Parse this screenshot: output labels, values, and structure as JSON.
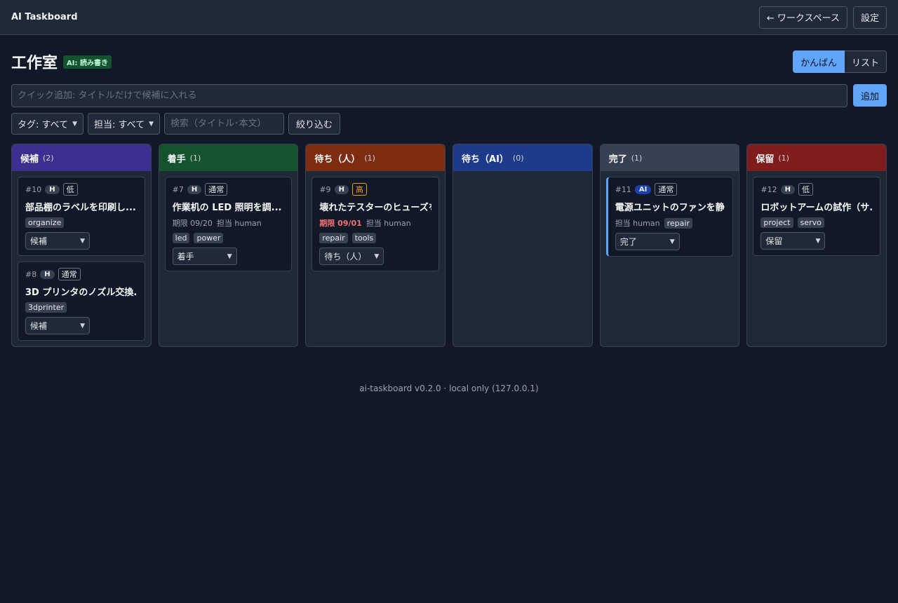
{
  "app": {
    "brand": "AI Taskboard"
  },
  "topbar": {
    "workspace_label": "← ワークスペース",
    "settings_label": "設定"
  },
  "page": {
    "title": "工作室",
    "ai_badge": "AI: 読み書き"
  },
  "view_toggle": {
    "kanban": "かんばん",
    "list": "リスト",
    "active": "kanban"
  },
  "quick_add": {
    "placeholder": "クイック追加: タイトルだけで候補に入れる",
    "button": "追加"
  },
  "filters": {
    "tag": "タグ: すべて",
    "assignee": "担当: すべて",
    "search_placeholder": "検索（タイトル･本文）",
    "apply": "絞り込む"
  },
  "columns": [
    {
      "name": "候補",
      "count": "(2)",
      "color": "#3b2f8f",
      "cards": [
        {
          "id": "#10",
          "who": "H",
          "prio": "低",
          "title": "部品棚のラベルを印刷し...",
          "tags": [
            "organize"
          ],
          "status": "候補"
        },
        {
          "id": "#8",
          "who": "H",
          "prio": "通常",
          "title": "3D プリンタのノズル交換...",
          "tags": [
            "3dprinter"
          ],
          "status": "候補"
        }
      ]
    },
    {
      "name": "着手",
      "count": "(1)",
      "color": "#14532d",
      "cards": [
        {
          "id": "#7",
          "who": "H",
          "prio": "通常",
          "title": "作業机の LED 照明を調...",
          "due": "期限 09/20",
          "assignee": "担当 human",
          "tags": [
            "led",
            "power"
          ],
          "status": "着手"
        }
      ]
    },
    {
      "name": "待ち（人）",
      "count": "(1)",
      "color": "#7c2d12",
      "cards": [
        {
          "id": "#9",
          "who": "H",
          "prio": "高",
          "title": "壊れたテスターのヒューズを...",
          "due": "期限 09/01",
          "assignee": "担当 human",
          "tags": [
            "repair",
            "tools"
          ],
          "status": "待ち（人）"
        }
      ]
    },
    {
      "name": "待ち（AI）",
      "count": "(0)",
      "color": "#1e3a8a",
      "cards": []
    },
    {
      "name": "完了",
      "count": "(1)",
      "color": "#374151",
      "cards": [
        {
          "id": "#11",
          "who": "AI",
          "prio": "通常",
          "title": "電源ユニットのファンを静...",
          "assignee": "担当 human",
          "tags": [
            "repair"
          ],
          "status": "完了"
        }
      ]
    },
    {
      "name": "保留",
      "count": "(1)",
      "color": "#7f1d1d",
      "cards": [
        {
          "id": "#12",
          "who": "H",
          "prio": "低",
          "title": "ロボットアームの試作（サ...",
          "tags": [
            "project",
            "servo"
          ],
          "status": "保留"
        }
      ]
    }
  ],
  "footer": "ai-taskboard v0.2.0 · local only (127.0.0.1)"
}
